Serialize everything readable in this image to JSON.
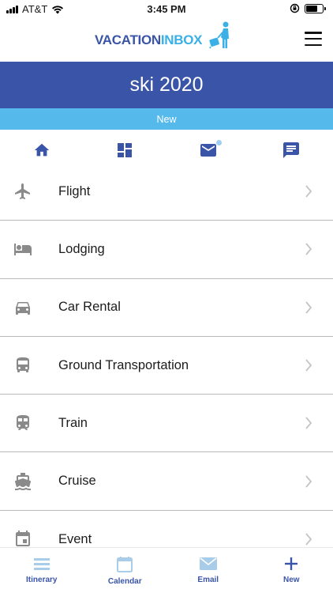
{
  "status_bar": {
    "carrier": "AT&T",
    "time": "3:45 PM"
  },
  "header": {
    "logo_part1": "VACATION",
    "logo_part2": "INBOX"
  },
  "trip": {
    "title": "ski 2020",
    "status": "New"
  },
  "icon_nav": [
    {
      "icon": "home-icon"
    },
    {
      "icon": "dashboard-icon"
    },
    {
      "icon": "mail-icon"
    },
    {
      "icon": "message-icon"
    }
  ],
  "categories": [
    {
      "label": "Flight",
      "icon": "airplane-icon"
    },
    {
      "label": "Lodging",
      "icon": "hotel-bed-icon"
    },
    {
      "label": "Car Rental",
      "icon": "car-icon"
    },
    {
      "label": "Ground Transportation",
      "icon": "bus-icon"
    },
    {
      "label": "Train",
      "icon": "train-icon"
    },
    {
      "label": "Cruise",
      "icon": "ship-icon"
    },
    {
      "label": "Event",
      "icon": "calendar-event-icon"
    }
  ],
  "tabs": [
    {
      "label": "Itinerary",
      "icon": "itinerary-icon"
    },
    {
      "label": "Calendar",
      "icon": "calendar-icon"
    },
    {
      "label": "Email",
      "icon": "email-icon"
    },
    {
      "label": "New",
      "icon": "plus-icon"
    }
  ],
  "colors": {
    "primary": "#3a55a8",
    "accent": "#56b9ec",
    "icon_gray": "#8a8a8a",
    "tab_dim": "#a9cde9"
  }
}
